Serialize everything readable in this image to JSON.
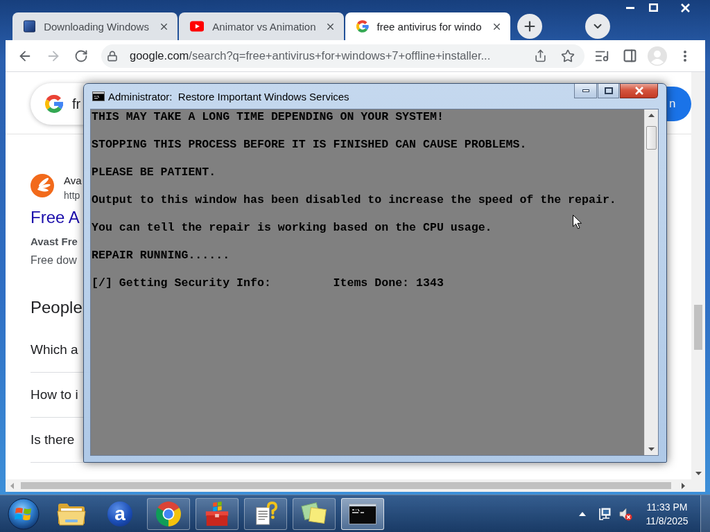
{
  "browser": {
    "tabs": [
      {
        "kind": "page",
        "title": "Downloading Windows",
        "selected": false
      },
      {
        "kind": "video",
        "title": "Animator vs Animation",
        "selected": false
      },
      {
        "kind": "search",
        "title": "free antivirus for windo",
        "selected": true
      }
    ],
    "navigation": {
      "back_disabled": false,
      "forward_disabled": true
    },
    "address_bar": {
      "url": "google.com/search?q=free+antivirus+for+windows+7+offline+installer..."
    },
    "page": {
      "search_query": "fr",
      "sign_in_button": "n",
      "result": {
        "site_name": "Ava",
        "site_url": "http",
        "title": "Free A",
        "snippet_heading": "Avast Fre",
        "snippet": "Free dow"
      },
      "people_also_ask": {
        "heading": "People",
        "questions": [
          "Which a",
          "How to i",
          "Is there"
        ]
      }
    }
  },
  "console": {
    "title": "Administrator:  Restore Important Windows Services",
    "notice_lines": [
      "THIS MAY TAKE A LONG TIME DEPENDING ON YOUR SYSTEM!",
      "STOPPING THIS PROCESS BEFORE IT IS FINISHED CAN CAUSE PROBLEMS.",
      "PLEASE BE PATIENT.",
      "Output to this window has been disabled to increase the speed of the repair.",
      "You can tell the repair is working based on the CPU usage."
    ],
    "status_lines": [
      "REPAIR RUNNING......",
      "[/] Getting Security Info:         Items Done: 1343"
    ]
  },
  "taskbar": {
    "apps": [
      {
        "kind": "folder",
        "running": false,
        "selected": false
      },
      {
        "kind": "letter-logo",
        "logo_text": "a",
        "running": false,
        "selected": false
      },
      {
        "kind": "browser",
        "running": true,
        "selected": false
      },
      {
        "kind": "toolbox",
        "running": true,
        "selected": false
      },
      {
        "kind": "help",
        "running": true,
        "selected": false
      },
      {
        "kind": "notes",
        "running": true,
        "selected": false
      },
      {
        "kind": "console",
        "running": true,
        "selected": true
      }
    ],
    "clock": {
      "time": "11:33 PM",
      "date": "11/8/2025"
    }
  }
}
